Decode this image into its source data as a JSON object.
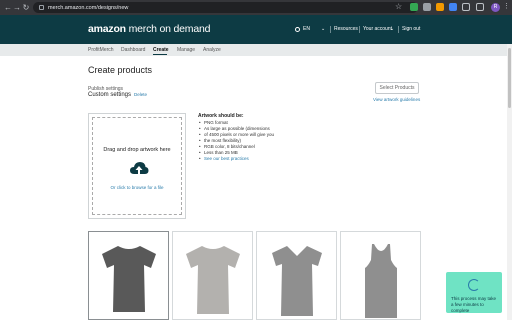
{
  "browser": {
    "url": "merch.amazon.com/designs/new",
    "profile_initial": "R",
    "extensions": [
      {
        "name": "star-icon",
        "color": "#bdc1c6"
      },
      {
        "name": "extension-green-icon",
        "color": "#34a853"
      },
      {
        "name": "extension-grey-icon",
        "color": "#9aa0a6"
      },
      {
        "name": "extension-orange-icon",
        "color": "#f29900"
      },
      {
        "name": "extension-blue-icon",
        "color": "#4285f4"
      },
      {
        "name": "puzzle-icon",
        "color": "#bdc1c6"
      },
      {
        "name": "sidebar-icon",
        "color": "#bdc1c6"
      }
    ]
  },
  "header": {
    "logo_amazon": "amazon",
    "logo_rest": "merch on demand",
    "language": "EN",
    "resources": "Resources",
    "account": "Your account",
    "signout": "Sign out",
    "bg_color": "#0d3b44"
  },
  "subnav": {
    "tabs": [
      "ProfitMerch",
      "Dashboard",
      "Create",
      "Manage",
      "Analyze"
    ],
    "active": "Create"
  },
  "main": {
    "title": "Create products",
    "published_label": "Publish settings",
    "settings_name": "Custom settings",
    "delete_label": "Delete",
    "select_products": "Select Products",
    "guidelines_link": "View artwork guidelines",
    "drop_title": "Drag and drop artwork here",
    "browse_link": "Or click to browse for a file",
    "requirements_title": "Artwork should be:",
    "requirements": [
      "PNG format",
      "As large as possible (dimensions",
      "of 4500 pixels or more will give you",
      "the most flexibility)",
      "RGB color, 8 bits/channel",
      "Less than 25 MB"
    ],
    "best_practices": "See our best practices"
  },
  "products": [
    {
      "name": "T-shirt",
      "color": "#595959"
    },
    {
      "name": "Premium T-shirt",
      "color": "#b3b1ae"
    },
    {
      "name": "V-neck T-shirt",
      "color": "#8f8f8f"
    },
    {
      "name": "Tank top",
      "color": "#8f8f8f"
    }
  ],
  "toast": {
    "text": "This process may take a few minutes to complete",
    "color": "#6fe3c4"
  }
}
